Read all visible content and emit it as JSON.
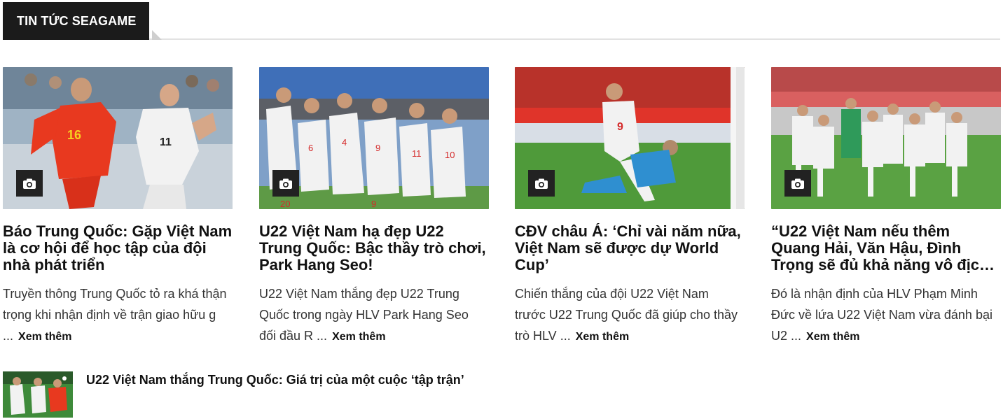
{
  "section": {
    "title": "TIN TỨC SEAGAME"
  },
  "articles": [
    {
      "title": "Báo Trung Quốc: Gặp Việt Nam là cơ hội để học tập của đội nhà phát triển",
      "excerpt": "Truyền thông Trung Quốc tỏ ra khá thận trọng khi nhận định về trận giao hữu g ...",
      "more": "Xem thêm",
      "icon": "camera-icon"
    },
    {
      "title": "U22 Việt Nam hạ đẹp U22 Trung Quốc: Bậc thầy trò chơi, Park Hang Seo!",
      "excerpt": "U22 Việt Nam thắng đẹp U22 Trung Quốc trong ngày HLV Park Hang Seo đối đầu R ...",
      "more": "Xem thêm",
      "icon": "camera-icon"
    },
    {
      "title": "CĐV châu Á: ‘Chỉ vài năm nữa, Việt Nam sẽ được dự World Cup’",
      "excerpt": "Chiến thắng của đội U22 Việt Nam trước U22 Trung Quốc đã giúp cho thầy trò HLV ...",
      "more": "Xem thêm",
      "icon": "camera-icon"
    },
    {
      "title": "“U22 Việt Nam nếu thêm Quang Hải, Văn Hậu, Đình Trọng sẽ đủ khả năng vô địc…",
      "excerpt": "Đó là nhận định của HLV Phạm Minh Đức về lứa U22 Việt Nam vừa đánh bại U2 ...",
      "more": "Xem thêm",
      "icon": "camera-icon"
    }
  ],
  "list": [
    {
      "title": "U22 Việt Nam thắng Trung Quốc: Giá trị của một cuộc ‘tập trận’"
    }
  ],
  "colors": {
    "header_bg": "#1b1b1b",
    "vn_red": "#d42a2a",
    "cn_red": "#e8391f",
    "pitch_green": "#4f9a3a",
    "stand_blue": "#3f6fb8",
    "kit_white": "#f2f2f2"
  }
}
